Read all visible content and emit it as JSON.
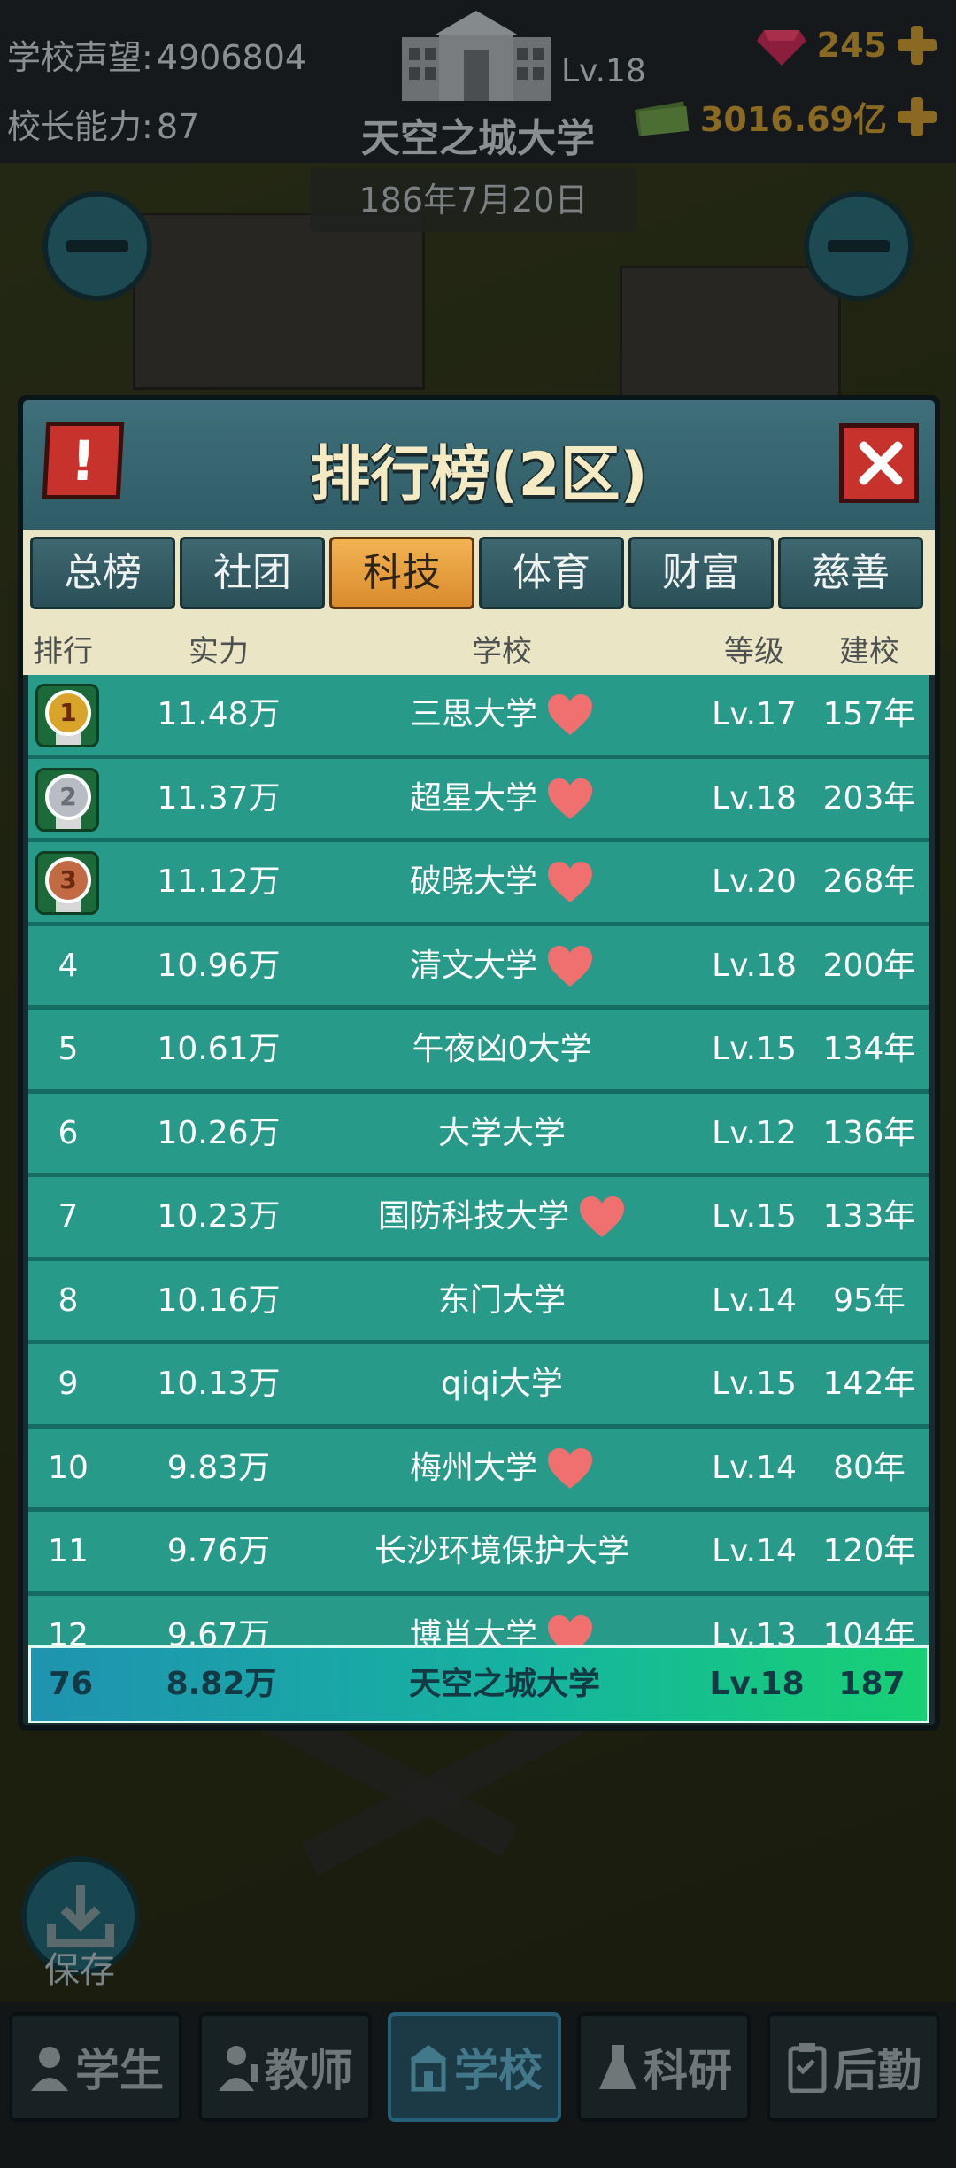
{
  "top": {
    "reputation_label": "学校声望:",
    "reputation_value": "4906804",
    "ability_label": "校长能力:",
    "ability_value": "87",
    "school_level": "Lv.18",
    "school_name": "天空之城大学",
    "gems": "245",
    "money": "3016.69亿",
    "date": "186年7月20日"
  },
  "modal": {
    "title": "排行榜(2区)",
    "alert_icon": "!",
    "tabs": [
      {
        "label": "总榜",
        "active": false
      },
      {
        "label": "社团",
        "active": false
      },
      {
        "label": "科技",
        "active": true
      },
      {
        "label": "体育",
        "active": false
      },
      {
        "label": "财富",
        "active": false
      },
      {
        "label": "慈善",
        "active": false
      }
    ],
    "columns": {
      "rank": "排行",
      "power": "实力",
      "school": "学校",
      "level": "等级",
      "age": "建校"
    },
    "rows": [
      {
        "rank": "1",
        "power": "11.48万",
        "school": "三思大学",
        "heart": true,
        "level": "Lv.17",
        "age": "157年",
        "medal": "gold"
      },
      {
        "rank": "2",
        "power": "11.37万",
        "school": "超星大学",
        "heart": true,
        "level": "Lv.18",
        "age": "203年",
        "medal": "silver"
      },
      {
        "rank": "3",
        "power": "11.12万",
        "school": "破晓大学",
        "heart": true,
        "level": "Lv.20",
        "age": "268年",
        "medal": "bronze"
      },
      {
        "rank": "4",
        "power": "10.96万",
        "school": "清文大学",
        "heart": true,
        "level": "Lv.18",
        "age": "200年"
      },
      {
        "rank": "5",
        "power": "10.61万",
        "school": "午夜凶0大学",
        "heart": false,
        "level": "Lv.15",
        "age": "134年"
      },
      {
        "rank": "6",
        "power": "10.26万",
        "school": "大学大学",
        "heart": false,
        "level": "Lv.12",
        "age": "136年"
      },
      {
        "rank": "7",
        "power": "10.23万",
        "school": "国防科技大学",
        "heart": true,
        "level": "Lv.15",
        "age": "133年"
      },
      {
        "rank": "8",
        "power": "10.16万",
        "school": "东门大学",
        "heart": false,
        "level": "Lv.14",
        "age": "95年"
      },
      {
        "rank": "9",
        "power": "10.13万",
        "school": "qiqi大学",
        "heart": false,
        "level": "Lv.15",
        "age": "142年"
      },
      {
        "rank": "10",
        "power": "9.83万",
        "school": "梅州大学",
        "heart": true,
        "level": "Lv.14",
        "age": "80年"
      },
      {
        "rank": "11",
        "power": "9.76万",
        "school": "长沙环境保护大学",
        "heart": false,
        "level": "Lv.14",
        "age": "120年"
      },
      {
        "rank": "12",
        "power": "9.67万",
        "school": "博肖大学",
        "heart": true,
        "level": "Lv.13",
        "age": "104年"
      }
    ],
    "my_row": {
      "rank": "76",
      "power": "8.82万",
      "school": "天空之城大学",
      "level": "Lv.18",
      "age": "187"
    }
  },
  "save_label": "保存",
  "nav": [
    {
      "label": "学生",
      "icon": "student-icon",
      "active": false
    },
    {
      "label": "教师",
      "icon": "teacher-icon",
      "active": false
    },
    {
      "label": "学校",
      "icon": "school-icon",
      "active": true
    },
    {
      "label": "科研",
      "icon": "flask-icon",
      "active": false
    },
    {
      "label": "后勤",
      "icon": "clipboard-icon",
      "active": false
    }
  ],
  "colors": {
    "row": "#279a8a",
    "active_tab": "#f3b352",
    "gold": "#d8a52a",
    "silver": "#b8bcc4",
    "bronze": "#c26a44",
    "heart": "#f07070"
  }
}
